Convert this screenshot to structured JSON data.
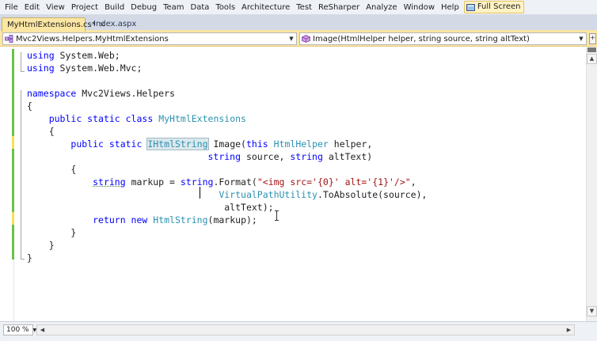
{
  "menu": [
    "File",
    "Edit",
    "View",
    "Project",
    "Build",
    "Debug",
    "Team",
    "Data",
    "Tools",
    "Architecture",
    "Test",
    "ReSharper",
    "Analyze",
    "Window",
    "Help"
  ],
  "menu_fullscreen": "Full Screen",
  "tabs": [
    {
      "label": "MyHtmlExtensions.cs*",
      "active": true,
      "close": "×"
    },
    {
      "label": "Index.aspx",
      "active": false
    }
  ],
  "nav": {
    "left": "Mvc2Views.Helpers.MyHtmlExtensions",
    "right": "Image(HtmlHelper helper, string source, string altText)"
  },
  "code": [
    [
      [
        "kw",
        "using"
      ],
      [
        "pl",
        " System.Web;"
      ]
    ],
    [
      [
        "kw",
        "using"
      ],
      [
        "pl",
        " System.Web.Mvc;"
      ]
    ],
    [],
    [
      [
        "kw",
        "namespace"
      ],
      [
        "pl",
        " Mvc2Views.Helpers"
      ]
    ],
    [
      [
        "pl",
        "{"
      ]
    ],
    [
      [
        "pl",
        "    "
      ],
      [
        "kw",
        "public static class"
      ],
      [
        "pl",
        " "
      ],
      [
        "ty",
        "MyHtmlExtensions"
      ]
    ],
    [
      [
        "pl",
        "    {"
      ]
    ],
    [
      [
        "pl",
        "        "
      ],
      [
        "kw",
        "public static"
      ],
      [
        "pl",
        " "
      ],
      [
        "ty",
        "IHtmlString"
      ],
      [
        "pl",
        " Image("
      ],
      [
        "kw",
        "this"
      ],
      [
        "pl",
        " "
      ],
      [
        "ty",
        "HtmlHelper"
      ],
      [
        "pl",
        " helper,"
      ]
    ],
    [
      [
        "pl",
        "                                 "
      ],
      [
        "kw",
        "string"
      ],
      [
        "pl",
        " source, "
      ],
      [
        "kw",
        "string"
      ],
      [
        "pl",
        " altText)"
      ]
    ],
    [
      [
        "pl",
        "        {"
      ]
    ],
    [
      [
        "pl",
        "            "
      ],
      [
        "kw",
        "string"
      ],
      [
        "pl",
        " markup = "
      ],
      [
        "kw",
        "string"
      ],
      [
        "pl",
        ".Format("
      ],
      [
        "st",
        "\"<img src='{0}' alt='{1}'/>\""
      ],
      [
        "pl",
        ","
      ]
    ],
    [
      [
        "pl",
        "                                   "
      ],
      [
        "ty",
        "VirtualPathUtility"
      ],
      [
        "pl",
        ".ToAbsolute(source),"
      ]
    ],
    [
      [
        "pl",
        "                                    altText);"
      ]
    ],
    [
      [
        "pl",
        "            "
      ],
      [
        "kw",
        "return new"
      ],
      [
        "pl",
        " "
      ],
      [
        "ty",
        "HtmlString"
      ],
      [
        "pl",
        "(markup);"
      ]
    ],
    [
      [
        "pl",
        "        }"
      ]
    ],
    [
      [
        "pl",
        "    }"
      ]
    ],
    [
      [
        "pl",
        "}"
      ]
    ]
  ],
  "zoom": "100 %",
  "colors": {
    "keyword": "#0000ff",
    "type": "#2b91af",
    "string": "#a31515",
    "change_saved": "#6cc24a",
    "change_unsaved": "#f5e05a",
    "tab_active": "#fce6a3"
  },
  "icons": {
    "fullscreen": "fullscreen-icon",
    "nav_left": "class-icon",
    "nav_right": "method-icon"
  }
}
